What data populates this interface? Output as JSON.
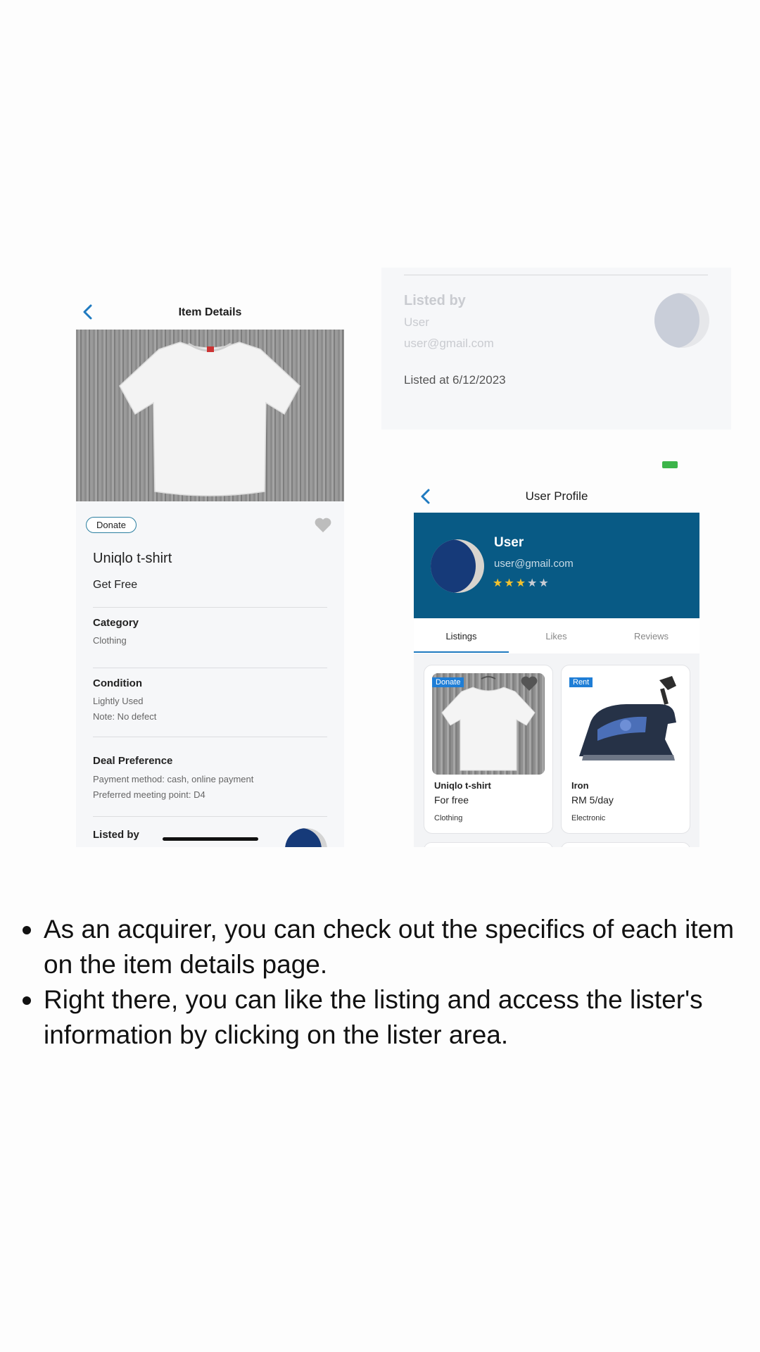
{
  "item_details": {
    "nav_title": "Item Details",
    "badge": "Donate",
    "item_title": "Uniqlo t-shirt",
    "price": "Get Free",
    "category": {
      "heading": "Category",
      "value": "Clothing"
    },
    "condition": {
      "heading": "Condition",
      "value": "Lightly Used",
      "note": "Note: No defect"
    },
    "deal": {
      "heading": "Deal Preference",
      "payment": "Payment method: cash, online payment",
      "meeting": "Preferred meeting point: D4"
    },
    "listed_by_heading": "Listed by",
    "icons": [
      "chevron-left-icon",
      "heart-icon"
    ]
  },
  "lister_card": {
    "heading": "Listed by",
    "name": "User",
    "email": "user@gmail.com",
    "listed_at": "Listed at 6/12/2023"
  },
  "user_profile": {
    "nav_title": "User Profile",
    "name": "User",
    "email": "user@gmail.com",
    "rating": 3,
    "rating_max": 5,
    "tabs": [
      "Listings",
      "Likes",
      "Reviews"
    ],
    "active_tab": "Listings",
    "listings": [
      {
        "tag": "Donate",
        "name": "Uniqlo t-shirt",
        "price": "For free",
        "category": "Clothing"
      },
      {
        "tag": "Rent",
        "name": "Iron",
        "price": "RM 5/day",
        "category": "Electronic"
      }
    ]
  },
  "bullets": [
    "As an acquirer, you can check out the specifics of each item on the item details page.",
    "Right there, you can like the listing and access the lister's information by clicking on the lister area."
  ],
  "colors": {
    "accent_blue": "#1f7ac0",
    "profile_header": "#085a85",
    "star_filled": "#f2c12e",
    "star_empty": "#c8ccd3"
  }
}
